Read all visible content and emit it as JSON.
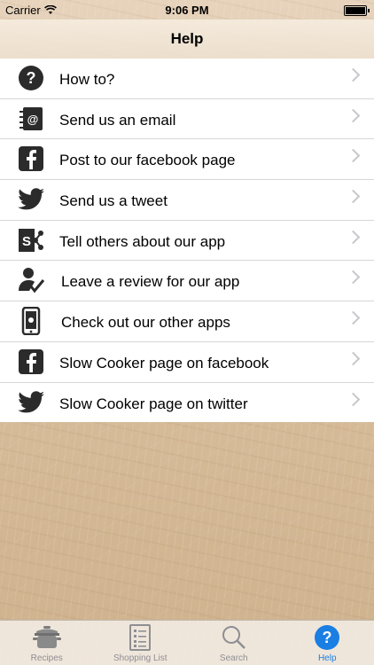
{
  "status_bar": {
    "carrier": "Carrier",
    "time": "9:06 PM"
  },
  "navbar": {
    "title": "Help"
  },
  "menu": {
    "items": [
      {
        "label": "How to?",
        "icon": "question-icon"
      },
      {
        "label": "Send us an email",
        "icon": "email-book-icon"
      },
      {
        "label": "Post to our facebook page",
        "icon": "facebook-icon"
      },
      {
        "label": "Send us a tweet",
        "icon": "twitter-bird-icon"
      },
      {
        "label": "Tell others about our app",
        "icon": "share-icon"
      },
      {
        "label": "Leave a review for our app",
        "icon": "review-person-icon"
      },
      {
        "label": "Check out our other apps",
        "icon": "phone-apple-icon"
      },
      {
        "label": "Slow Cooker page on facebook",
        "icon": "facebook-icon"
      },
      {
        "label": "Slow Cooker page on twitter",
        "icon": "twitter-bird-icon"
      }
    ]
  },
  "tabs": [
    {
      "label": "Recipes",
      "icon": "pot-icon"
    },
    {
      "label": "Shopping List",
      "icon": "list-icon"
    },
    {
      "label": "Search",
      "icon": "magnifier-icon"
    },
    {
      "label": "Help",
      "icon": "help-icon",
      "active": true
    }
  ],
  "colors": {
    "accent": "#1a7ee3",
    "icon_dark": "#2b2b2b",
    "tab_inactive": "#8e8e93"
  }
}
